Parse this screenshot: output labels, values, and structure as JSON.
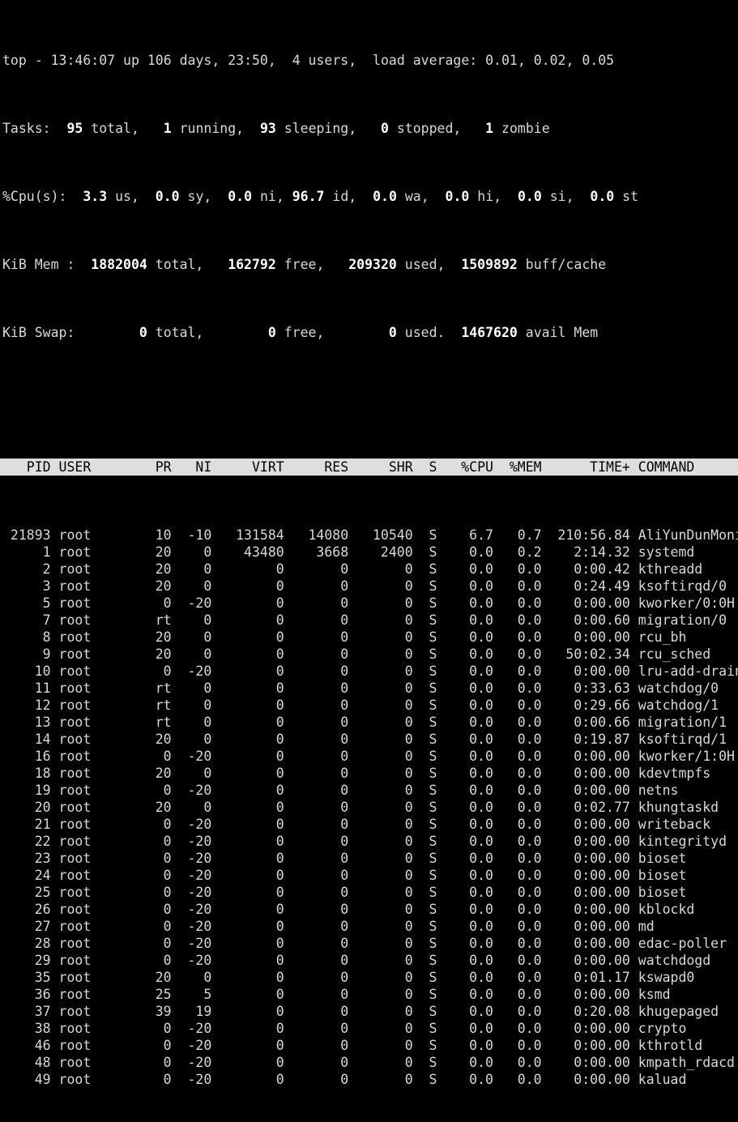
{
  "window": {
    "title": "top",
    "background_color": "#000000",
    "foreground_color": "#d8d8d8",
    "header_band_color": "#dedede",
    "header_band_text_color": "#000000"
  },
  "summary": {
    "uptime_line": {
      "program": "top",
      "separator": "-",
      "time": "13:46:07",
      "up_label": "up",
      "uptime": "106 days, 23:50,",
      "users": "4 users,",
      "load_label": "load average:",
      "load_avg_1": "0.01",
      "load_avg_5": "0.02",
      "load_avg_15": "0.05"
    },
    "tasks_line": {
      "label": "Tasks:",
      "total": "95",
      "total_label": "total,",
      "running": "1",
      "running_label": "running,",
      "sleeping": "93",
      "sleeping_label": "sleeping,",
      "stopped": "0",
      "stopped_label": "stopped,",
      "zombie": "1",
      "zombie_label": "zombie"
    },
    "cpu_line": {
      "label": "%Cpu(s):",
      "us": "3.3",
      "us_label": "us,",
      "sy": "0.0",
      "sy_label": "sy,",
      "ni": "0.0",
      "ni_label": "ni,",
      "id": "96.7",
      "id_label": "id,",
      "wa": "0.0",
      "wa_label": "wa,",
      "hi": "0.0",
      "hi_label": "hi,",
      "si": "0.0",
      "si_label": "si,",
      "st": "0.0",
      "st_label": "st"
    },
    "mem_line": {
      "label": "KiB Mem :",
      "total": "1882004",
      "total_label": "total,",
      "free": "162792",
      "free_label": "free,",
      "used": "209320",
      "used_label": "used,",
      "buff_cache": "1509892",
      "buff_cache_label": "buff/cache"
    },
    "swap_line": {
      "label": "KiB Swap:",
      "total": "0",
      "total_label": "total,",
      "free": "0",
      "free_label": "free,",
      "used": "0",
      "used_label": "used.",
      "avail": "1467620",
      "avail_label": "avail Mem"
    }
  },
  "table": {
    "columns": [
      {
        "key": "pid",
        "label": "PID",
        "width": 6,
        "align": "right"
      },
      {
        "key": "user",
        "label": "USER",
        "width": 9,
        "align": "left"
      },
      {
        "key": "pr",
        "label": "PR",
        "width": 4,
        "align": "right"
      },
      {
        "key": "ni",
        "label": "NI",
        "width": 4,
        "align": "right"
      },
      {
        "key": "virt",
        "label": "VIRT",
        "width": 8,
        "align": "right"
      },
      {
        "key": "res",
        "label": "RES",
        "width": 7,
        "align": "right"
      },
      {
        "key": "shr",
        "label": "SHR",
        "width": 7,
        "align": "right"
      },
      {
        "key": "s",
        "label": "S",
        "width": 2,
        "align": "right"
      },
      {
        "key": "cpu",
        "label": "%CPU",
        "width": 6,
        "align": "right"
      },
      {
        "key": "mem",
        "label": "%MEM",
        "width": 5,
        "align": "right"
      },
      {
        "key": "time",
        "label": "TIME+",
        "width": 10,
        "align": "right"
      },
      {
        "key": "command",
        "label": "COMMAND",
        "width": 0,
        "align": "left"
      }
    ],
    "rows": [
      {
        "pid": "21893",
        "user": "root",
        "pr": "10",
        "ni": "-10",
        "virt": "131584",
        "res": "14080",
        "shr": "10540",
        "s": "S",
        "cpu": "6.7",
        "mem": "0.7",
        "time": "210:56.84",
        "command": "AliYunDunMonito"
      },
      {
        "pid": "1",
        "user": "root",
        "pr": "20",
        "ni": "0",
        "virt": "43480",
        "res": "3668",
        "shr": "2400",
        "s": "S",
        "cpu": "0.0",
        "mem": "0.2",
        "time": "2:14.32",
        "command": "systemd"
      },
      {
        "pid": "2",
        "user": "root",
        "pr": "20",
        "ni": "0",
        "virt": "0",
        "res": "0",
        "shr": "0",
        "s": "S",
        "cpu": "0.0",
        "mem": "0.0",
        "time": "0:00.42",
        "command": "kthreadd"
      },
      {
        "pid": "3",
        "user": "root",
        "pr": "20",
        "ni": "0",
        "virt": "0",
        "res": "0",
        "shr": "0",
        "s": "S",
        "cpu": "0.0",
        "mem": "0.0",
        "time": "0:24.49",
        "command": "ksoftirqd/0"
      },
      {
        "pid": "5",
        "user": "root",
        "pr": "0",
        "ni": "-20",
        "virt": "0",
        "res": "0",
        "shr": "0",
        "s": "S",
        "cpu": "0.0",
        "mem": "0.0",
        "time": "0:00.00",
        "command": "kworker/0:0H"
      },
      {
        "pid": "7",
        "user": "root",
        "pr": "rt",
        "ni": "0",
        "virt": "0",
        "res": "0",
        "shr": "0",
        "s": "S",
        "cpu": "0.0",
        "mem": "0.0",
        "time": "0:00.60",
        "command": "migration/0"
      },
      {
        "pid": "8",
        "user": "root",
        "pr": "20",
        "ni": "0",
        "virt": "0",
        "res": "0",
        "shr": "0",
        "s": "S",
        "cpu": "0.0",
        "mem": "0.0",
        "time": "0:00.00",
        "command": "rcu_bh"
      },
      {
        "pid": "9",
        "user": "root",
        "pr": "20",
        "ni": "0",
        "virt": "0",
        "res": "0",
        "shr": "0",
        "s": "S",
        "cpu": "0.0",
        "mem": "0.0",
        "time": "50:02.34",
        "command": "rcu_sched"
      },
      {
        "pid": "10",
        "user": "root",
        "pr": "0",
        "ni": "-20",
        "virt": "0",
        "res": "0",
        "shr": "0",
        "s": "S",
        "cpu": "0.0",
        "mem": "0.0",
        "time": "0:00.00",
        "command": "lru-add-drain"
      },
      {
        "pid": "11",
        "user": "root",
        "pr": "rt",
        "ni": "0",
        "virt": "0",
        "res": "0",
        "shr": "0",
        "s": "S",
        "cpu": "0.0",
        "mem": "0.0",
        "time": "0:33.63",
        "command": "watchdog/0"
      },
      {
        "pid": "12",
        "user": "root",
        "pr": "rt",
        "ni": "0",
        "virt": "0",
        "res": "0",
        "shr": "0",
        "s": "S",
        "cpu": "0.0",
        "mem": "0.0",
        "time": "0:29.66",
        "command": "watchdog/1"
      },
      {
        "pid": "13",
        "user": "root",
        "pr": "rt",
        "ni": "0",
        "virt": "0",
        "res": "0",
        "shr": "0",
        "s": "S",
        "cpu": "0.0",
        "mem": "0.0",
        "time": "0:00.66",
        "command": "migration/1"
      },
      {
        "pid": "14",
        "user": "root",
        "pr": "20",
        "ni": "0",
        "virt": "0",
        "res": "0",
        "shr": "0",
        "s": "S",
        "cpu": "0.0",
        "mem": "0.0",
        "time": "0:19.87",
        "command": "ksoftirqd/1"
      },
      {
        "pid": "16",
        "user": "root",
        "pr": "0",
        "ni": "-20",
        "virt": "0",
        "res": "0",
        "shr": "0",
        "s": "S",
        "cpu": "0.0",
        "mem": "0.0",
        "time": "0:00.00",
        "command": "kworker/1:0H"
      },
      {
        "pid": "18",
        "user": "root",
        "pr": "20",
        "ni": "0",
        "virt": "0",
        "res": "0",
        "shr": "0",
        "s": "S",
        "cpu": "0.0",
        "mem": "0.0",
        "time": "0:00.00",
        "command": "kdevtmpfs"
      },
      {
        "pid": "19",
        "user": "root",
        "pr": "0",
        "ni": "-20",
        "virt": "0",
        "res": "0",
        "shr": "0",
        "s": "S",
        "cpu": "0.0",
        "mem": "0.0",
        "time": "0:00.00",
        "command": "netns"
      },
      {
        "pid": "20",
        "user": "root",
        "pr": "20",
        "ni": "0",
        "virt": "0",
        "res": "0",
        "shr": "0",
        "s": "S",
        "cpu": "0.0",
        "mem": "0.0",
        "time": "0:02.77",
        "command": "khungtaskd"
      },
      {
        "pid": "21",
        "user": "root",
        "pr": "0",
        "ni": "-20",
        "virt": "0",
        "res": "0",
        "shr": "0",
        "s": "S",
        "cpu": "0.0",
        "mem": "0.0",
        "time": "0:00.00",
        "command": "writeback"
      },
      {
        "pid": "22",
        "user": "root",
        "pr": "0",
        "ni": "-20",
        "virt": "0",
        "res": "0",
        "shr": "0",
        "s": "S",
        "cpu": "0.0",
        "mem": "0.0",
        "time": "0:00.00",
        "command": "kintegrityd"
      },
      {
        "pid": "23",
        "user": "root",
        "pr": "0",
        "ni": "-20",
        "virt": "0",
        "res": "0",
        "shr": "0",
        "s": "S",
        "cpu": "0.0",
        "mem": "0.0",
        "time": "0:00.00",
        "command": "bioset"
      },
      {
        "pid": "24",
        "user": "root",
        "pr": "0",
        "ni": "-20",
        "virt": "0",
        "res": "0",
        "shr": "0",
        "s": "S",
        "cpu": "0.0",
        "mem": "0.0",
        "time": "0:00.00",
        "command": "bioset"
      },
      {
        "pid": "25",
        "user": "root",
        "pr": "0",
        "ni": "-20",
        "virt": "0",
        "res": "0",
        "shr": "0",
        "s": "S",
        "cpu": "0.0",
        "mem": "0.0",
        "time": "0:00.00",
        "command": "bioset"
      },
      {
        "pid": "26",
        "user": "root",
        "pr": "0",
        "ni": "-20",
        "virt": "0",
        "res": "0",
        "shr": "0",
        "s": "S",
        "cpu": "0.0",
        "mem": "0.0",
        "time": "0:00.00",
        "command": "kblockd"
      },
      {
        "pid": "27",
        "user": "root",
        "pr": "0",
        "ni": "-20",
        "virt": "0",
        "res": "0",
        "shr": "0",
        "s": "S",
        "cpu": "0.0",
        "mem": "0.0",
        "time": "0:00.00",
        "command": "md"
      },
      {
        "pid": "28",
        "user": "root",
        "pr": "0",
        "ni": "-20",
        "virt": "0",
        "res": "0",
        "shr": "0",
        "s": "S",
        "cpu": "0.0",
        "mem": "0.0",
        "time": "0:00.00",
        "command": "edac-poller"
      },
      {
        "pid": "29",
        "user": "root",
        "pr": "0",
        "ni": "-20",
        "virt": "0",
        "res": "0",
        "shr": "0",
        "s": "S",
        "cpu": "0.0",
        "mem": "0.0",
        "time": "0:00.00",
        "command": "watchdogd"
      },
      {
        "pid": "35",
        "user": "root",
        "pr": "20",
        "ni": "0",
        "virt": "0",
        "res": "0",
        "shr": "0",
        "s": "S",
        "cpu": "0.0",
        "mem": "0.0",
        "time": "0:01.17",
        "command": "kswapd0"
      },
      {
        "pid": "36",
        "user": "root",
        "pr": "25",
        "ni": "5",
        "virt": "0",
        "res": "0",
        "shr": "0",
        "s": "S",
        "cpu": "0.0",
        "mem": "0.0",
        "time": "0:00.00",
        "command": "ksmd"
      },
      {
        "pid": "37",
        "user": "root",
        "pr": "39",
        "ni": "19",
        "virt": "0",
        "res": "0",
        "shr": "0",
        "s": "S",
        "cpu": "0.0",
        "mem": "0.0",
        "time": "0:20.08",
        "command": "khugepaged"
      },
      {
        "pid": "38",
        "user": "root",
        "pr": "0",
        "ni": "-20",
        "virt": "0",
        "res": "0",
        "shr": "0",
        "s": "S",
        "cpu": "0.0",
        "mem": "0.0",
        "time": "0:00.00",
        "command": "crypto"
      },
      {
        "pid": "46",
        "user": "root",
        "pr": "0",
        "ni": "-20",
        "virt": "0",
        "res": "0",
        "shr": "0",
        "s": "S",
        "cpu": "0.0",
        "mem": "0.0",
        "time": "0:00.00",
        "command": "kthrotld"
      },
      {
        "pid": "48",
        "user": "root",
        "pr": "0",
        "ni": "-20",
        "virt": "0",
        "res": "0",
        "shr": "0",
        "s": "S",
        "cpu": "0.0",
        "mem": "0.0",
        "time": "0:00.00",
        "command": "kmpath_rdacd"
      },
      {
        "pid": "49",
        "user": "root",
        "pr": "0",
        "ni": "-20",
        "virt": "0",
        "res": "0",
        "shr": "0",
        "s": "S",
        "cpu": "0.0",
        "mem": "0.0",
        "time": "0:00.00",
        "command": "kaluad"
      }
    ]
  }
}
